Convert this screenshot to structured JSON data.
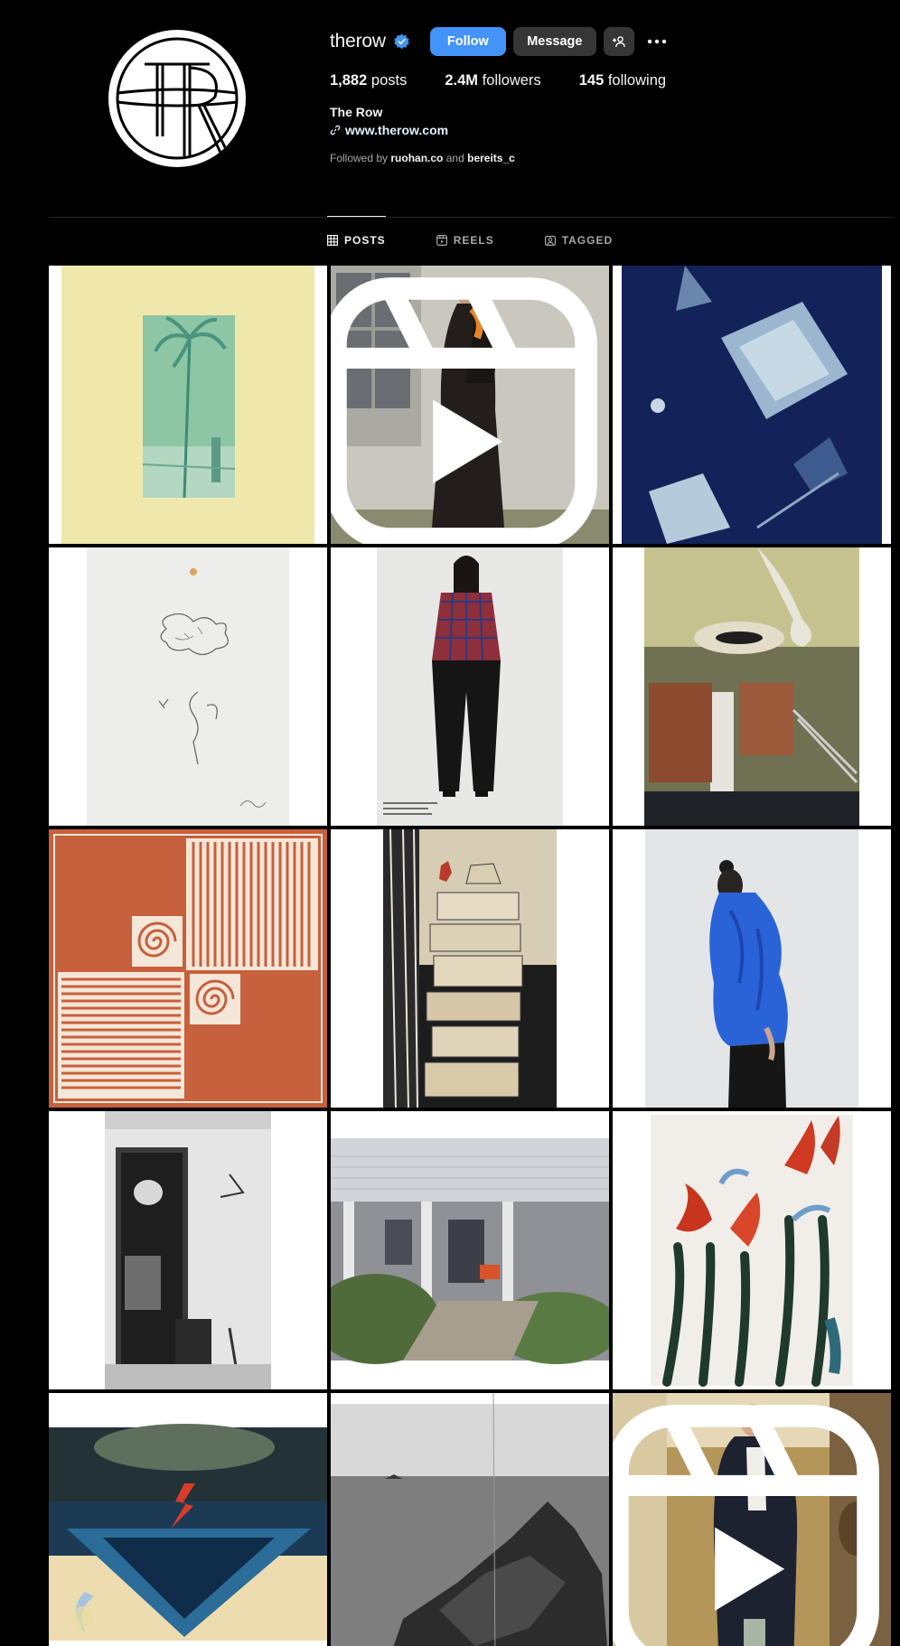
{
  "profile": {
    "username": "therow",
    "follow_label": "Follow",
    "message_label": "Message",
    "fullname": "The Row",
    "website": "www.therow.com",
    "followed_by_prefix": "Followed by",
    "followed_by_user1": "ruohan.co",
    "followed_by_and": "and",
    "followed_by_user2": "bereits_c"
  },
  "stats": {
    "posts_count": "1,882",
    "posts_label": "posts",
    "followers_count": "2.4M",
    "followers_label": "followers",
    "following_count": "145",
    "following_label": "following"
  },
  "tabs": [
    {
      "label": "POSTS",
      "active": true
    },
    {
      "label": "REELS",
      "active": false
    },
    {
      "label": "TAGGED",
      "active": false
    }
  ],
  "posts": [
    {
      "subject": "palm tree print on yellow paper",
      "reel": false
    },
    {
      "subject": "model in long black coat by window",
      "reel": true
    },
    {
      "subject": "blue abstract painting",
      "reel": false
    },
    {
      "subject": "pencil sketch drawing",
      "reel": false
    },
    {
      "subject": "model in plaid shirt",
      "reel": false
    },
    {
      "subject": "modernist interior with columns",
      "reel": false
    },
    {
      "subject": "orange spiral pattern print",
      "reel": false
    },
    {
      "subject": "still life painting of stacked books",
      "reel": false
    },
    {
      "subject": "model in blue draped top",
      "reel": false
    },
    {
      "subject": "black and white interior photo",
      "reel": false
    },
    {
      "subject": "house with porch",
      "reel": false
    },
    {
      "subject": "abstract floral painting",
      "reel": false
    },
    {
      "subject": "lightning over sea painting",
      "reel": false
    },
    {
      "subject": "black and white rocky coast",
      "reel": false
    },
    {
      "subject": "model in dark coat in hallway",
      "reel": true
    }
  ],
  "colors": {
    "accent": "#4493f8",
    "background": "#000000",
    "button_secondary": "#363636",
    "text_primary": "#f5f5f5",
    "text_secondary": "#a8a8a8"
  }
}
